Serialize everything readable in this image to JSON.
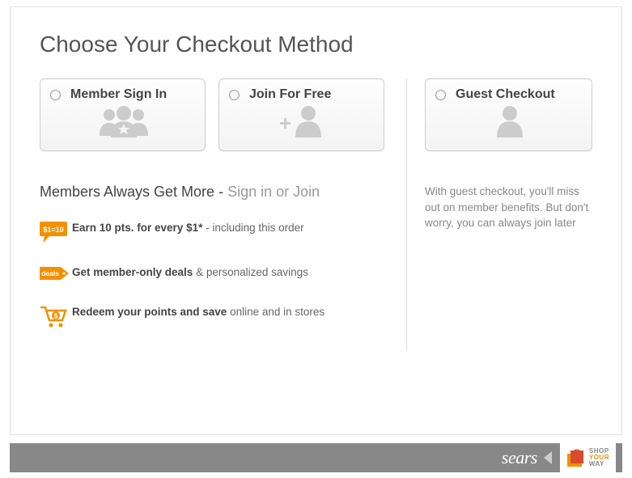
{
  "title": "Choose Your Checkout Method",
  "options": {
    "member": "Member Sign In",
    "join": "Join For Free",
    "guest": "Guest Checkout"
  },
  "subhead": {
    "strong": "Members Always Get More",
    "dash": " - ",
    "light": "Sign in or Join"
  },
  "benefits": {
    "b1_bold": "Earn 10 pts. for every $1*",
    "b1_rest": " - including this order",
    "b2_bold": "Get member-only deals",
    "b2_rest": " & personalized savings",
    "b3_bold": "Redeem your points and save",
    "b3_rest": " online and in stores",
    "badge1": "$1=10",
    "badge2": "deals"
  },
  "guest_note": "With guest checkout, you'll miss out on member benefits. But don't worry, you can always join later",
  "footer": {
    "brand": "sears",
    "syw1": "SHOP",
    "syw2": "YOUR",
    "syw3": "WAY"
  }
}
